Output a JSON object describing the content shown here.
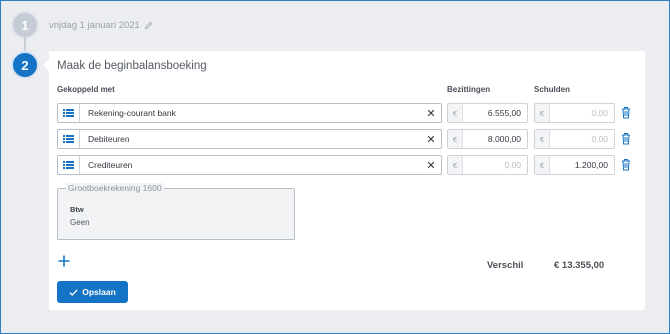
{
  "steps": {
    "step1": {
      "number": "1",
      "text": "vrijdag 1 januari 2021",
      "icon": "pencil-icon"
    },
    "step2": {
      "number": "2"
    }
  },
  "card": {
    "title": "Maak de beginbalansboeking",
    "columns": {
      "linked": "Gekoppeld met",
      "assets": "Bezittingen",
      "debts": "Schulden"
    },
    "rows": [
      {
        "account": "Rekening-courant bank",
        "currency": "€",
        "assets": "6.555,00",
        "debts": "0,00",
        "assets_filled": true,
        "debts_filled": false
      },
      {
        "account": "Debiteuren",
        "currency": "€",
        "assets": "8.000,00",
        "debts": "0,00",
        "assets_filled": true,
        "debts_filled": false
      },
      {
        "account": "Crediteuren",
        "currency": "€",
        "assets": "0,00",
        "debts": "1.200,00",
        "assets_filled": false,
        "debts_filled": true
      }
    ],
    "ledger": {
      "legend": "Grootboekrekening 1600",
      "btw_label": "Btw",
      "btw_value": "Geen"
    },
    "add_icon": "plus-icon",
    "difference": {
      "label": "Verschil",
      "value": "€ 13.355,00"
    },
    "save_label": "Opslaan"
  },
  "colors": {
    "accent": "#1473c4",
    "frame": "#2b7fc3",
    "background": "#ecedf0"
  }
}
